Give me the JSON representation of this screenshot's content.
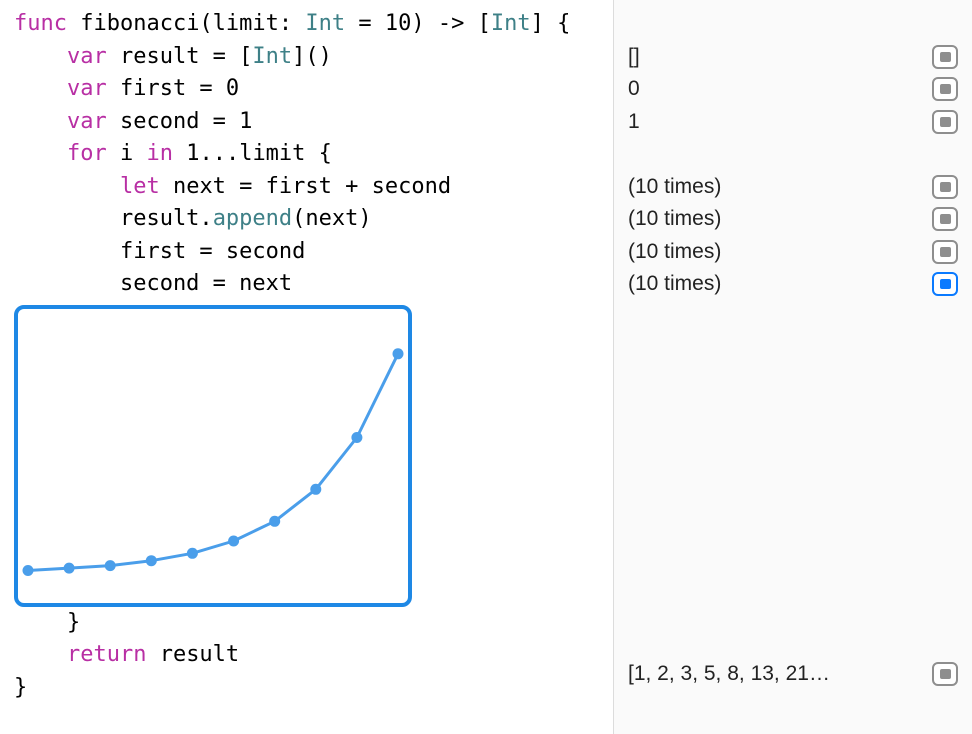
{
  "code": {
    "line1_a": "func",
    "line1_b": " fibonacci(limit: ",
    "line1_c": "Int",
    "line1_d": " = 10) -> [",
    "line1_e": "Int",
    "line1_f": "] {",
    "line2_a": "    var",
    "line2_b": " result = [",
    "line2_c": "Int",
    "line2_d": "]()",
    "line3_a": "    var",
    "line3_b": " first = 0",
    "line4_a": "    var",
    "line4_b": " second = 1",
    "line5_a": "    for",
    "line5_b": " i ",
    "line5_c": "in",
    "line5_d": " 1...limit {",
    "line6_a": "        let",
    "line6_b": " next = first + second",
    "line7_a": "        result.",
    "line7_b": "append",
    "line7_c": "(next)",
    "line8": "        first = second",
    "line9": "        second = next",
    "line10": "    }",
    "line11_a": "    return",
    "line11_b": " result",
    "line12": "}"
  },
  "results": {
    "r1": "[]",
    "r2": "0",
    "r3": "1",
    "r4": "(10 times)",
    "r5": "(10 times)",
    "r6": "(10 times)",
    "r7": "(10 times)",
    "r8": "[1, 2, 3, 5, 8, 13, 21…"
  },
  "chart_data": {
    "type": "line",
    "x": [
      1,
      2,
      3,
      4,
      5,
      6,
      7,
      8,
      9,
      10
    ],
    "values": [
      1,
      2,
      3,
      5,
      8,
      13,
      21,
      34,
      55,
      89
    ],
    "title": "",
    "xlabel": "",
    "ylabel": "",
    "ylim": [
      0,
      95
    ],
    "color": "#4a9eea"
  }
}
